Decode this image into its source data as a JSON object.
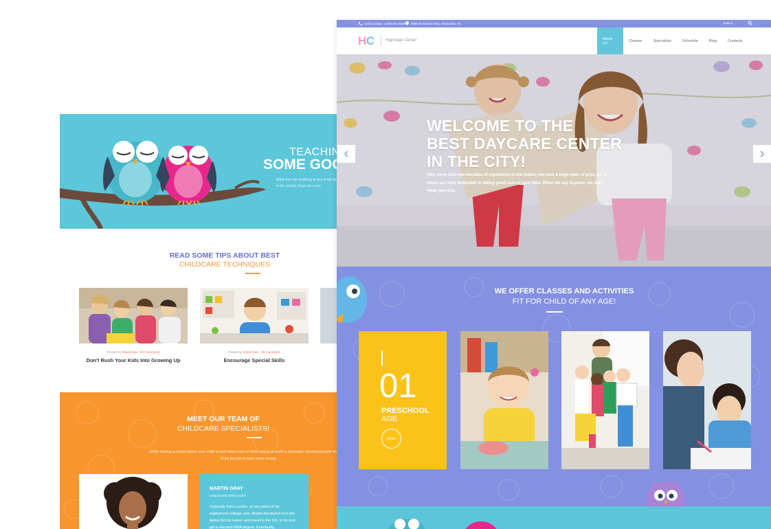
{
  "back_page": {
    "hero": {
      "title_line1": "TEACHING",
      "title_line2": "SOME GOO",
      "text": "While the role modeling is one of the behave in the society, there are s syn"
    },
    "tips": {
      "title_line1": "READ SOME TIPS ABOUT BEST",
      "title_line2": "CHILDCARE TECHNIQUES",
      "posts": [
        {
          "meta_prefix": "Posted by",
          "author": "Shane Doe",
          "comments": "25 Comments",
          "title": "Don't Rush Your Kids Into Growing Up"
        },
        {
          "meta_prefix": "Posted by",
          "author": "Shane Doe",
          "comments": "25 Comments",
          "title": "Encourage Special Skills"
        }
      ]
    },
    "team": {
      "title_line1": "MEET OUR TEAM OF",
      "title_line2": "CHILDCARE SPECIALISTS!",
      "text": "While having a center where your child is well taken care of while you're at work is important, knowing people there are fit for the job is even more crucial.",
      "member": {
        "name": "MARTIN GRAY",
        "role": "CHILDCARE SPECIALIST",
        "bio": "Originally from London, at one point of his sophomore college year, Martin decided to turn the tables for his career and travel to the US, to try and get a Harvard MBA degree. Eventually,"
      }
    }
  },
  "front_page": {
    "topbar": {
      "phone": "Call us today: 1-555-344-5566",
      "address": "9580 Richmond Hwy, Alexandria, VA",
      "search_placeholder": "Search..."
    },
    "logo": {
      "h": "H",
      "c": "C",
      "name": "Highridge Center"
    },
    "menu": [
      "About Us",
      "Classes",
      "Specialists",
      "Schedule",
      "Blog",
      "Contacts"
    ],
    "hero": {
      "line1": "WELCOME TO THE",
      "line2": "BEST DAYCARE CENTER",
      "line3": "IN THE CITY!",
      "text": "With more than two decades of experience in the matter, we have a huge team of pros, all of whom are truly dedicated to taking good care of your kids. When we say daycare, we don't mean just that."
    },
    "classes": {
      "title_line1": "WE OFFER CLASSES AND ACTIVITIES",
      "title_line2": "FIT FOR CHILD OF ANY AGE!",
      "feature": {
        "number": "01",
        "label1": "PRESCHOOL",
        "label2": "AGE",
        "more": "More"
      }
    }
  },
  "colors": {
    "sky": "#5cc6da",
    "lavender": "#8490e1",
    "orange": "#f8952d",
    "yellow": "#fbc31a",
    "pink": "#e8278a"
  }
}
